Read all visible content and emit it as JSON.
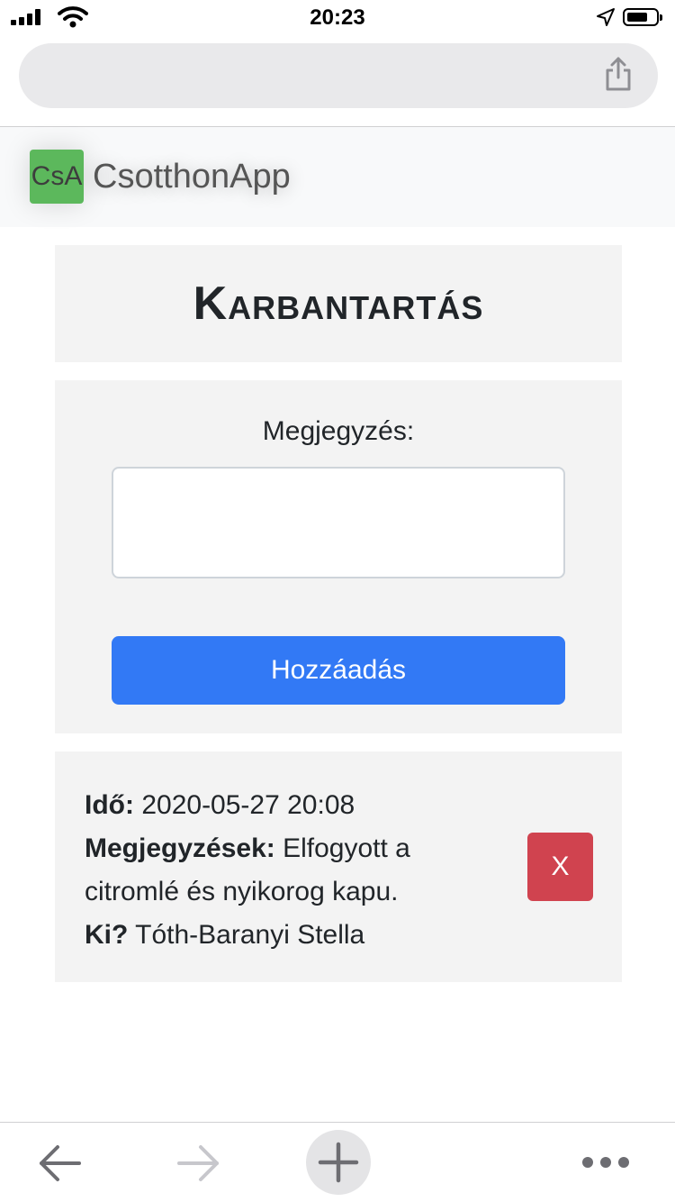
{
  "status_bar": {
    "time": "20:23"
  },
  "navbar": {
    "logo_text": "CsA",
    "brand": "CsotthonApp"
  },
  "page": {
    "title": "Karbantartás"
  },
  "form": {
    "label": "Megjegyzés:",
    "note_value": "",
    "add_label": "Hozzáadás"
  },
  "entries": [
    {
      "time_label": "Idő:",
      "time_value": "2020-05-27 20:08",
      "notes_label": "Megjegyzések:",
      "notes_value": "Elfogyott a citromlé és nyikorog kapu.",
      "who_label": "Ki?",
      "who_value": "Tóth-Baranyi Stella",
      "delete_label": "X"
    }
  ],
  "colors": {
    "accent": "#3279f5",
    "danger": "#d0434f",
    "brand_logo": "#5cb85c"
  },
  "icons": [
    "signal-icon",
    "wifi-icon",
    "location-arrow-icon",
    "battery-icon",
    "share-icon",
    "back-arrow-icon",
    "forward-arrow-icon",
    "plus-icon",
    "more-dots-icon"
  ]
}
